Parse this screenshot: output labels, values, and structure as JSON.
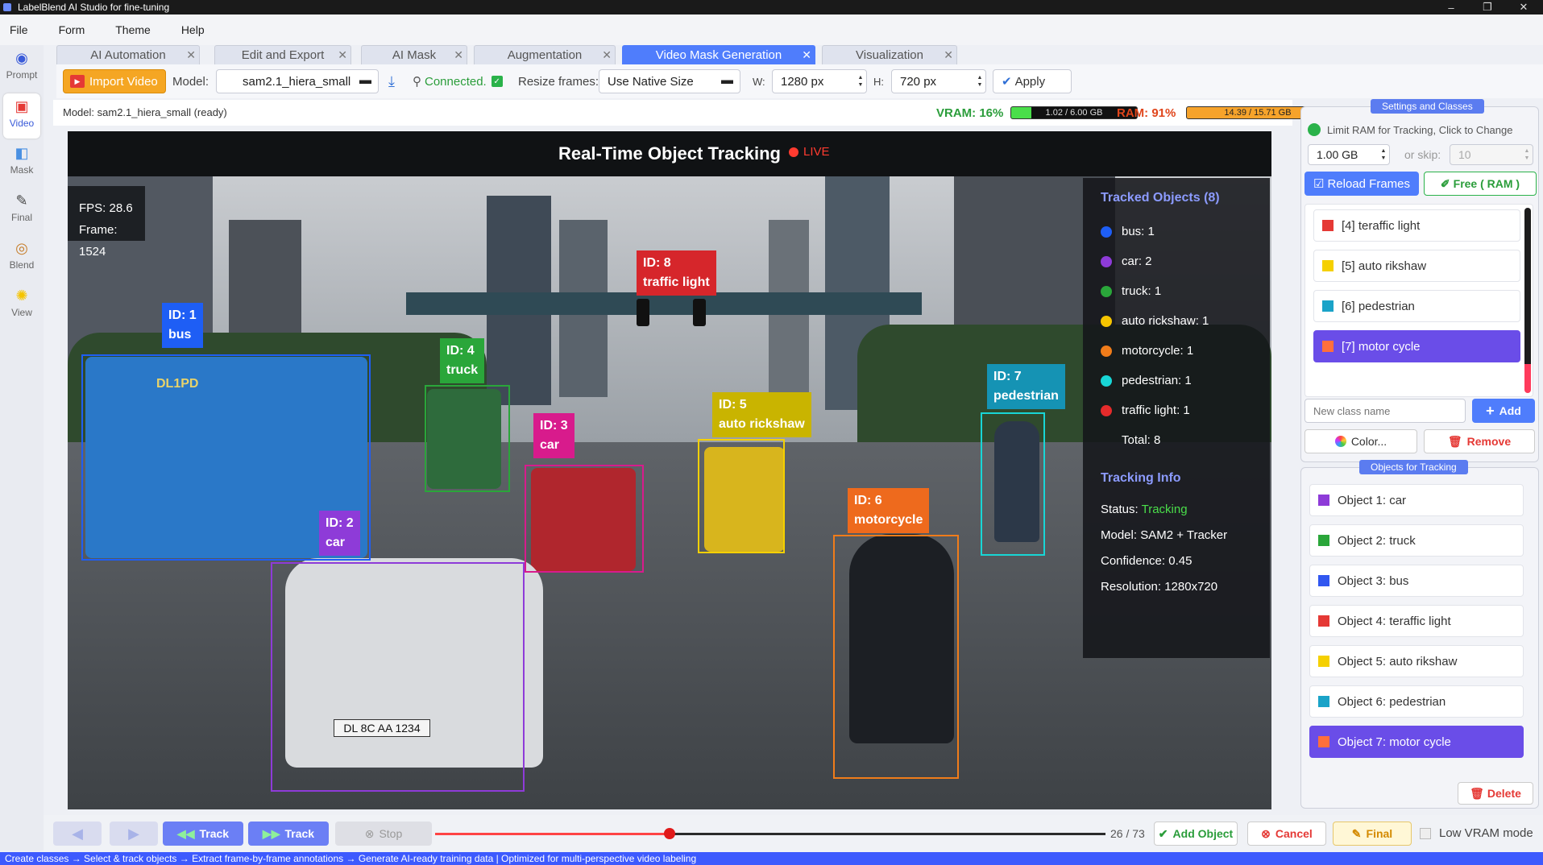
{
  "window": {
    "title": "LabelBlend AI Studio for fine-tuning",
    "minimize": "–",
    "maximize": "❐",
    "close": "✕"
  },
  "menu": [
    "File",
    "Form",
    "Theme",
    "Help"
  ],
  "sidebar": [
    {
      "label": "Prompt",
      "icon": "prompt-icon"
    },
    {
      "label": "Video",
      "icon": "video-icon"
    },
    {
      "label": "Mask",
      "icon": "mask-icon"
    },
    {
      "label": "Final",
      "icon": "final-icon"
    },
    {
      "label": "Blend",
      "icon": "blend-icon"
    },
    {
      "label": "View",
      "icon": "view-icon"
    }
  ],
  "tabs": [
    "AI Automation",
    "Edit and Export",
    "AI Mask",
    "Augmentation",
    "Video Mask Generation",
    "Visualization"
  ],
  "tab_close": "✕",
  "toolbar": {
    "import_label": "Import Video",
    "model_label": "Model:",
    "model_value": "sam2.1_hiera_small",
    "connected": "Connected.",
    "resize_label": "Resize frames:",
    "resize_value": "Use Native Size",
    "w_label": "W:",
    "w_value": "1280 px",
    "h_label": "H:",
    "h_value": "720 px",
    "apply_label": "Apply"
  },
  "status": {
    "model_status": "Model: sam2.1_hiera_small (ready)",
    "vram_label": "VRAM: 16%",
    "vram_bar": "1.02 / 6.00 GB",
    "vram_fraction": 0.16,
    "ram_label": "RAM: 91%",
    "ram_bar": "14.39 / 15.71 GB",
    "ram_fraction": 0.91
  },
  "video": {
    "title": "Real-Time Object Tracking",
    "live": "LIVE",
    "fps": "FPS: 28.6",
    "frame": "Frame: 1524",
    "detections": [
      {
        "id": "ID: 1",
        "name": "bus",
        "color": "#1e5ef5"
      },
      {
        "id": "ID: 2",
        "name": "car",
        "color": "#8e3bd8"
      },
      {
        "id": "ID: 3",
        "name": "car",
        "color": "#d81b8c"
      },
      {
        "id": "ID: 4",
        "name": "truck",
        "color": "#2aa63a"
      },
      {
        "id": "ID: 5",
        "name": "auto rickshaw",
        "color": "#c9b400"
      },
      {
        "id": "ID: 6",
        "name": "motorcycle",
        "color": "#ee6a1d"
      },
      {
        "id": "ID: 7",
        "name": "pedestrian",
        "color": "#1593b4"
      },
      {
        "id": "ID: 8",
        "name": "traffic light",
        "color": "#d6262b"
      }
    ],
    "plates": [
      "DL 8C AA 1234",
      "DL1PD"
    ],
    "panel": {
      "title": "Tracked Objects (8)",
      "rows": [
        {
          "label": "bus: 1",
          "color": "#1e5ef5"
        },
        {
          "label": "car: 2",
          "color": "#8e3bd8"
        },
        {
          "label": "truck: 1",
          "color": "#2aa63a"
        },
        {
          "label": "auto rickshaw: 1",
          "color": "#f5c400"
        },
        {
          "label": "motorcycle: 1",
          "color": "#f07c1a"
        },
        {
          "label": "pedestrian: 1",
          "color": "#18d6d6"
        },
        {
          "label": "traffic light: 1",
          "color": "#e52b2b"
        }
      ],
      "total": "Total: 8",
      "info_title": "Tracking Info",
      "status_prefix": "Status:",
      "status_value": "Tracking",
      "model": "Model: SAM2 + Tracker",
      "confidence": "Confidence: 0.45",
      "resolution": "Resolution: 1280x720"
    }
  },
  "settings": {
    "title": "Settings and Classes",
    "limit_label": "Limit RAM for Tracking, Click to Change",
    "limit_value": "1.00 GB",
    "skip_label": "or skip:",
    "skip_value": "10",
    "reload_label": "Reload Frames",
    "free_label": "Free ( RAM )",
    "classes": [
      {
        "label": "[4]  teraffic light",
        "color": "#e53935"
      },
      {
        "label": "[5]  auto rikshaw",
        "color": "#f5d000"
      },
      {
        "label": "[6]  pedestrian",
        "color": "#1aa3c8"
      },
      {
        "label": "[7]  motor cycle",
        "color": "#ff6f3c"
      }
    ],
    "new_class_placeholder": "New class name",
    "add_label": "Add",
    "color_label": "Color...",
    "remove_label": "Remove"
  },
  "objects": {
    "title": "Objects for Tracking",
    "items": [
      {
        "label": "Object 1: car",
        "color": "#8e3bd8"
      },
      {
        "label": "Object 2: truck",
        "color": "#2aa63a"
      },
      {
        "label": "Object 3: bus",
        "color": "#3157f0"
      },
      {
        "label": "Object 4: teraffic light",
        "color": "#e53935"
      },
      {
        "label": "Object 5: auto rikshaw",
        "color": "#f5d000"
      },
      {
        "label": "Object 6: pedestrian",
        "color": "#1aa3c8"
      },
      {
        "label": "Object 7: motor cycle",
        "color": "#ff6f3c"
      }
    ],
    "delete_label": "Delete"
  },
  "bottom": {
    "track_back": "Track",
    "track_fwd": "Track",
    "stop": "Stop",
    "progress": "26 / 73",
    "progress_fraction": 0.35,
    "add_object": "Add Object",
    "cancel": "Cancel",
    "final": "Final",
    "low_vram": "Low VRAM mode"
  },
  "footer": "Create classes → Select & track objects → Extract frame-by-frame annotations → Generate AI-ready training data | Optimized for multi-perspective video labeling",
  "colors": {
    "accent": "#4f7dfc",
    "selected": "#6a4de8",
    "import": "#f5a623"
  }
}
